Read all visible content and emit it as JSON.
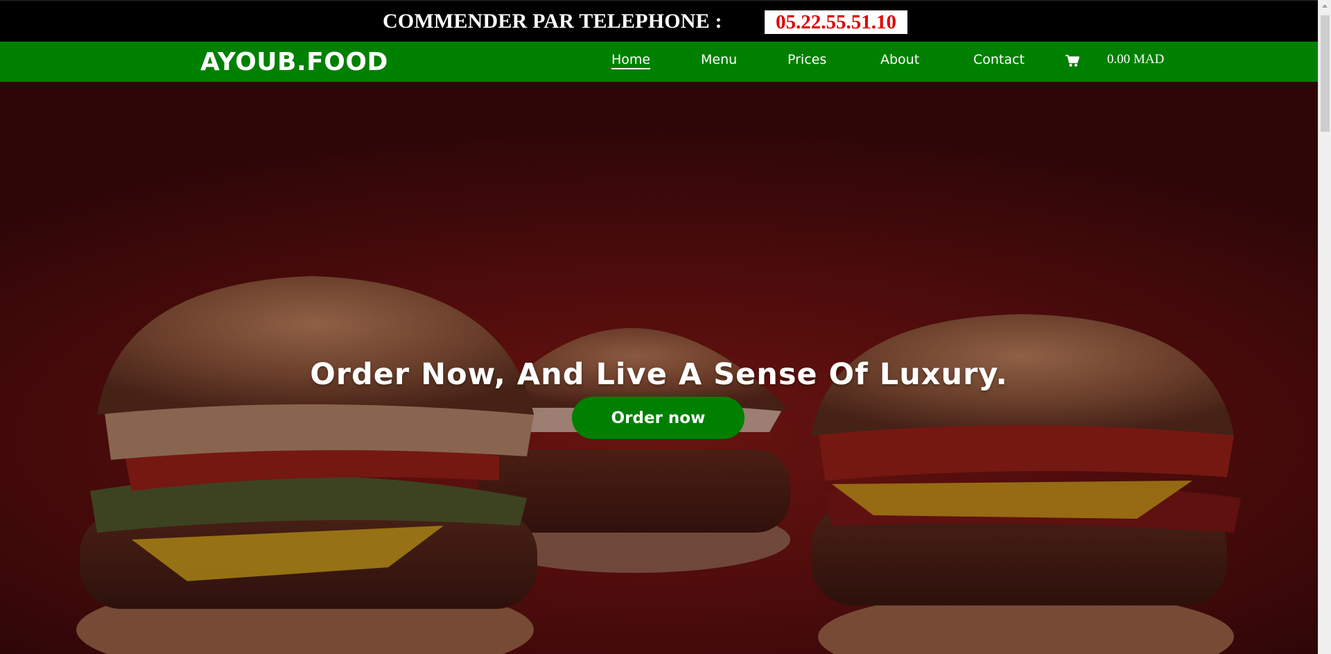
{
  "topbar": {
    "label": "COMMENDER PAR TELEPHONE :",
    "phone": "05.22.55.51.10"
  },
  "navbar": {
    "logo": "AYOUB.FOOD",
    "links": [
      {
        "label": "Home",
        "active": true
      },
      {
        "label": "Menu",
        "active": false
      },
      {
        "label": "Prices",
        "active": false
      },
      {
        "label": "About",
        "active": false
      },
      {
        "label": "Contact",
        "active": false
      }
    ],
    "cart_icon": "shopping-cart-icon",
    "cart_total": "0.00 MAD"
  },
  "hero": {
    "heading": "Order Now, And Live A Sense Of Luxury.",
    "button_label": "Order now",
    "background_image": "three-burgers-photo"
  },
  "colors": {
    "topbar_bg": "#000000",
    "nav_bg": "#008000",
    "phone_text": "#e00000",
    "button_bg": "#008000",
    "hero_bg": "#5a0f0e"
  }
}
